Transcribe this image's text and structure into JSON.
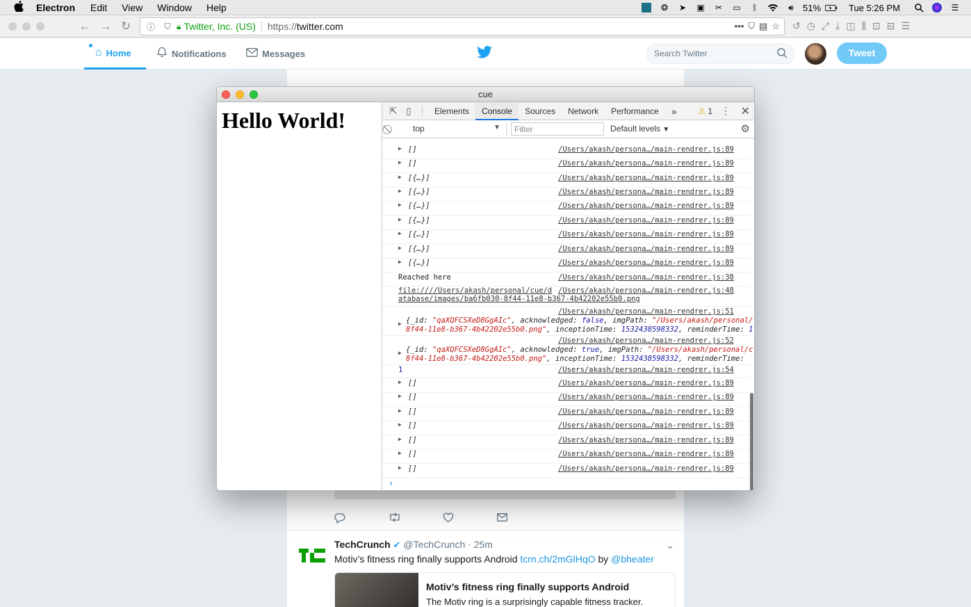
{
  "menubar": {
    "app": "Electron",
    "items": [
      "Edit",
      "View",
      "Window",
      "Help"
    ],
    "battery": "51%",
    "clock": "Tue 5:26 PM"
  },
  "browser": {
    "org": "Twitter, Inc. (US)",
    "url_prefix": "https://",
    "url_host": "twitter.com",
    "more": "•••"
  },
  "twitter": {
    "nav": {
      "home": "Home",
      "notifications": "Notifications",
      "messages": "Messages"
    },
    "search_placeholder": "Search Twitter",
    "tweet_button": "Tweet",
    "card": {
      "name": "TechCrunch",
      "handle": "@TechCrunch",
      "time": "· 25m",
      "text": "Motiv’s fitness ring finally supports Android ",
      "link": "tcrn.ch/2mGlHqO",
      "by": " by ",
      "mention": "@bheater",
      "link_title": "Motiv’s fitness ring finally supports Android",
      "link_desc": "The Motiv ring is a surprisingly capable fitness tracker."
    }
  },
  "electron": {
    "title": "cue",
    "hello": "Hello World!"
  },
  "devtools": {
    "tabs": [
      "Elements",
      "Console",
      "Sources",
      "Network",
      "Performance"
    ],
    "active_tab": "Console",
    "more_tabs": "»",
    "warning_count": "1",
    "context": "top",
    "filter_placeholder": "Filter",
    "levels": "Default levels",
    "rows": [
      {
        "msg": "[]",
        "src": "/Users/akash/persona…/main-rendrer.js:89"
      },
      {
        "msg": "[]",
        "src": "/Users/akash/persona…/main-rendrer.js:89"
      },
      {
        "msg": "[{…}]",
        "src": "/Users/akash/persona…/main-rendrer.js:89"
      },
      {
        "msg": "[{…}]",
        "src": "/Users/akash/persona…/main-rendrer.js:89"
      },
      {
        "msg": "[{…}]",
        "src": "/Users/akash/persona…/main-rendrer.js:89"
      },
      {
        "msg": "[{…}]",
        "src": "/Users/akash/persona…/main-rendrer.js:89"
      },
      {
        "msg": "[{…}]",
        "src": "/Users/akash/persona…/main-rendrer.js:89"
      },
      {
        "msg": "[{…}]",
        "src": "/Users/akash/persona…/main-rendrer.js:89"
      },
      {
        "msg": "[{…}]",
        "src": "/Users/akash/persona…/main-rendrer.js:89"
      }
    ],
    "reached": {
      "msg": "Reached here",
      "src": "/Users/akash/persona…/main-rendrer.js:38"
    },
    "file_row": {
      "line1": "file:////Users/akash/personal/cue/d",
      "line2": "atabase/images/ba6fb030-8f44-11e8-b367-4b42202e55b0.png",
      "src": "/Users/akash/persona…/main-rendrer.js:48"
    },
    "obj1": {
      "src": "/Users/akash/persona…/main-rendrer.js:51",
      "id": "\"qaXQFCSXeD8GgAIc\"",
      "ack": "false",
      "img": "\"/Users/akash/personal/",
      "tail": "8f44-11e8-b367-4b42202e55b0.png\"",
      "time": "1532438598332",
      "rem": "1"
    },
    "obj2": {
      "src": "/Users/akash/persona…/main-rendrer.js:52",
      "id": "\"qaXQFCSXeD8GgAIc\"",
      "ack": "true",
      "img": "\"/Users/akash/personal/c",
      "tail": "8f44-11e8-b367-4b42202e55b0.png\"",
      "time": "1532438598332"
    },
    "num_row": {
      "msg": "1",
      "src": "/Users/akash/persona…/main-rendrer.js:54"
    },
    "rows2": [
      {
        "msg": "[]",
        "src": "/Users/akash/persona…/main-rendrer.js:89"
      },
      {
        "msg": "[]",
        "src": "/Users/akash/persona…/main-rendrer.js:89"
      },
      {
        "msg": "[]",
        "src": "/Users/akash/persona…/main-rendrer.js:89"
      },
      {
        "msg": "[]",
        "src": "/Users/akash/persona…/main-rendrer.js:89"
      },
      {
        "msg": "[]",
        "src": "/Users/akash/persona…/main-rendrer.js:89"
      },
      {
        "msg": "[]",
        "src": "/Users/akash/persona…/main-rendrer.js:89"
      },
      {
        "msg": "[]",
        "src": "/Users/akash/persona…/main-rendrer.js:89"
      }
    ]
  }
}
